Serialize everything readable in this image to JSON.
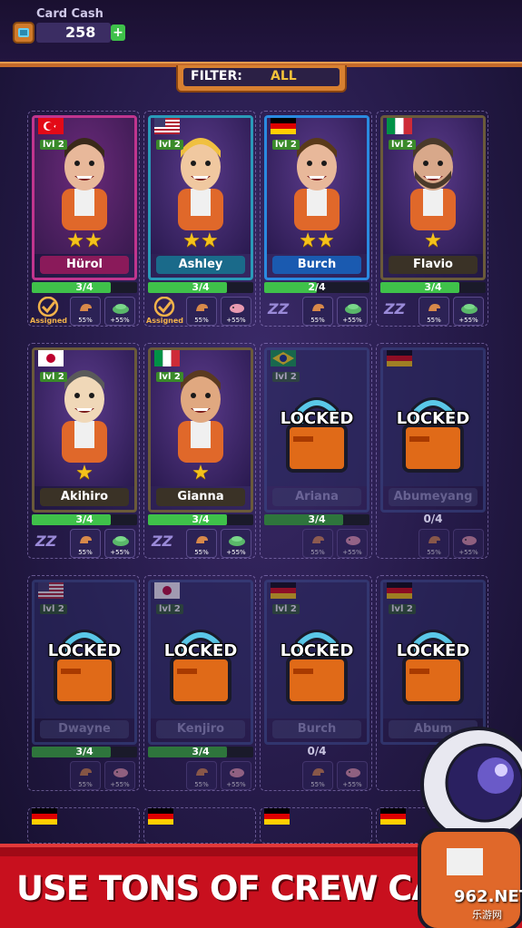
{
  "header": {
    "cash_label": "Card Cash",
    "cash_value": "258",
    "plus_label": "+",
    "filter_label": "FILTER:",
    "filter_value": "ALL"
  },
  "cards": [
    {
      "name": "Hürol",
      "level": "lvl 2",
      "flag": "turkey",
      "stars": "★★",
      "progress": "3/4",
      "fill": 0.75,
      "assigned": "Assigned",
      "trait1": "55%",
      "trait2": "+55%",
      "theme": "pink"
    },
    {
      "name": "Ashley",
      "level": "lvl 2",
      "flag": "usa",
      "stars": "★★",
      "progress": "3/4",
      "fill": 0.75,
      "assigned": "Assigned",
      "trait1": "55%",
      "trait2": "+55%",
      "theme": "teal"
    },
    {
      "name": "Burch",
      "level": "lvl 2",
      "flag": "germany",
      "stars": "★★",
      "progress": "2/4",
      "fill": 0.5,
      "trait1": "55%",
      "trait2": "+55%",
      "theme": "blue"
    },
    {
      "name": "Flavio",
      "level": "lvl 2",
      "flag": "italy",
      "stars": "★",
      "progress": "3/4",
      "fill": 0.75,
      "trait1": "55%",
      "trait2": "+55%",
      "theme": "olive"
    },
    {
      "name": "Akihiro",
      "level": "lvl 2",
      "flag": "japan",
      "stars": "★",
      "progress": "3/4",
      "fill": 0.75,
      "trait1": "55%",
      "trait2": "+55%",
      "theme": "olive"
    },
    {
      "name": "Gianna",
      "level": "lvl 2",
      "flag": "italy",
      "stars": "★",
      "progress": "3/4",
      "fill": 0.75,
      "trait1": "55%",
      "trait2": "+55%",
      "theme": "olive"
    }
  ],
  "locked_cards": [
    {
      "name": "Ariana",
      "level": "lvl 2",
      "progress": "3/4",
      "fill": 0.75,
      "trait1": "55%",
      "trait2": "+55%"
    },
    {
      "name": "Abumeyang",
      "level": "",
      "progress": "0/4",
      "fill": 0,
      "trait1": "55%",
      "trait2": "+55%"
    },
    {
      "name": "Dwayne",
      "level": "lvl 2",
      "progress": "3/4",
      "fill": 0.75,
      "trait1": "55%",
      "trait2": "+55%"
    },
    {
      "name": "Kenjiro",
      "level": "lvl 2",
      "progress": "3/4",
      "fill": 0.75,
      "trait1": "55%",
      "trait2": "+55%"
    },
    {
      "name": "Burch",
      "level": "lvl 2",
      "progress": "0/4",
      "fill": 0,
      "trait1": "55%",
      "trait2": "+55%"
    },
    {
      "name": "Abum",
      "level": "lvl 2",
      "progress": "",
      "fill": 0,
      "trait1": "",
      "trait2": ""
    }
  ],
  "locked_label": "LOCKED",
  "sleep_label": "ZZ",
  "banner": {
    "text": "USE TONS OF CREW CARDS"
  },
  "watermark": {
    "text": "962.NET",
    "sub": "乐游网"
  },
  "colors": {
    "accent": "#d88030",
    "green": "#3fc14a",
    "banner": "#c8101e",
    "star": "#f5c21a"
  }
}
